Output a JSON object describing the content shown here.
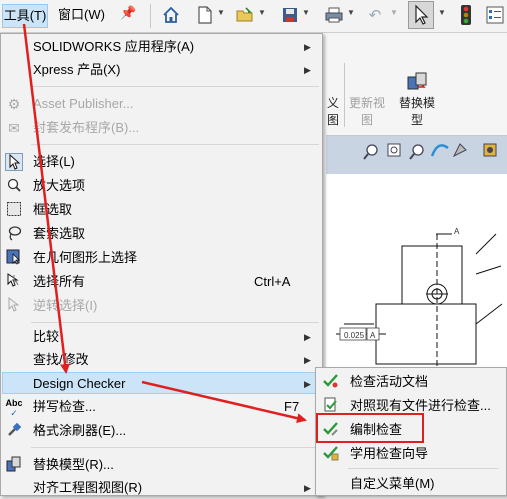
{
  "menubar": {
    "tools_label": "工具(T)",
    "window_label": "窗口(W)"
  },
  "toolbar": {
    "icons": [
      "pin-icon",
      "home-icon",
      "new-document-icon",
      "open-icon",
      "save-icon",
      "print-icon",
      "undo-icon",
      "select-icon",
      "traffic-light-icon",
      "options-icon"
    ]
  },
  "command_manager": {
    "partial_label_1": "义",
    "partial_label_2": "图",
    "update_view_1": "更新视",
    "update_view_2": "图",
    "replace_model_1": "替换模",
    "replace_model_2": "型"
  },
  "drawing": {
    "dim_a": "A",
    "dim_1": "0.025",
    "dim_2": "A"
  },
  "tools_menu": {
    "items": [
      {
        "label": "SOLIDWORKS 应用程序(A)",
        "submenu": true
      },
      {
        "label": "Xpress 产品(X)",
        "submenu": true
      },
      {
        "label": "Asset Publisher...",
        "disabled": true
      },
      {
        "label": "封套发布程序(B)...",
        "disabled": true
      },
      {
        "label": "选择(L)"
      },
      {
        "label": "放大选项"
      },
      {
        "label": "框选取"
      },
      {
        "label": "套索选取"
      },
      {
        "label": "在几何图形上选择"
      },
      {
        "label": "选择所有",
        "shortcut": "Ctrl+A"
      },
      {
        "label": "逆转选择(I)",
        "disabled": true
      },
      {
        "label": "比较",
        "submenu": true
      },
      {
        "label": "查找/修改",
        "submenu": true
      },
      {
        "label": "Design Checker",
        "submenu": true,
        "highlighted": true
      },
      {
        "label": "拼写检查...",
        "shortcut": "F7"
      },
      {
        "label": "格式涂刷器(E)..."
      },
      {
        "label": "替换模型(R)..."
      },
      {
        "label": "对齐工程图视图(R)",
        "submenu": true
      }
    ]
  },
  "design_checker_submenu": {
    "items": [
      {
        "label": "检查活动文档"
      },
      {
        "label": "对照现有文件进行检查..."
      },
      {
        "label": "编制检查",
        "boxed": true
      },
      {
        "label": "学用检查向导"
      },
      {
        "label": "自定义菜单(M)"
      }
    ]
  },
  "colors": {
    "highlight": "#cce4f7",
    "annotation_red": "#e02020",
    "menu_bg": "#f2f2f2"
  }
}
